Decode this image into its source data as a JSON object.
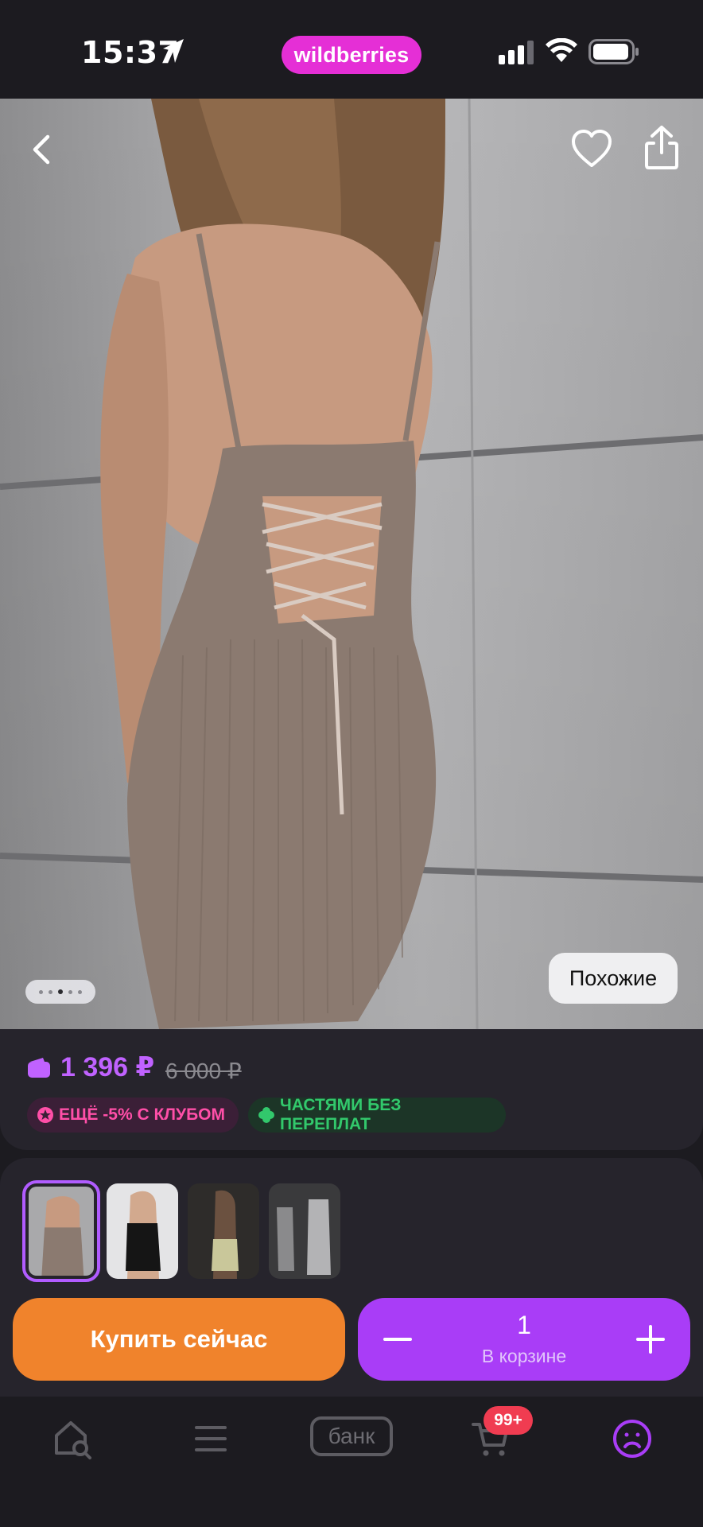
{
  "status_bar": {
    "time": "15:37",
    "brand": "wildberries",
    "icons": [
      "location-arrow-icon",
      "cellular-signal-icon",
      "wifi-icon",
      "battery-icon"
    ]
  },
  "hero": {
    "similar_label": "Похожие",
    "image_count": 5,
    "active_image_index": 3,
    "icons": [
      "back-chevron-icon",
      "heart-icon",
      "share-icon"
    ]
  },
  "price": {
    "current": "1 396 ₽",
    "old": "6 000 ₽",
    "club_badge": "ЕЩЁ -5% С КЛУБОМ",
    "parts_badge": "ЧАСТЯМИ БЕЗ ПЕРЕПЛАТ"
  },
  "gallery": {
    "thumb_count": 4,
    "selected_index": 0
  },
  "actions": {
    "buy_now": "Купить сейчас",
    "quantity": "1",
    "in_cart": "В корзине"
  },
  "nav": {
    "bank_label": "банк",
    "cart_badge": "99+",
    "items": [
      "search-home-icon",
      "menu-icon",
      "bank-icon",
      "cart-icon",
      "profile-icon"
    ]
  },
  "colors": {
    "background": "#1c1b20",
    "card": "#26242c",
    "accent_purple": "#a93df7",
    "price_purple": "#c062ff",
    "buy_orange": "#f0832c",
    "brand_pink": "#e52fd6",
    "badge_red": "#f03c51"
  }
}
